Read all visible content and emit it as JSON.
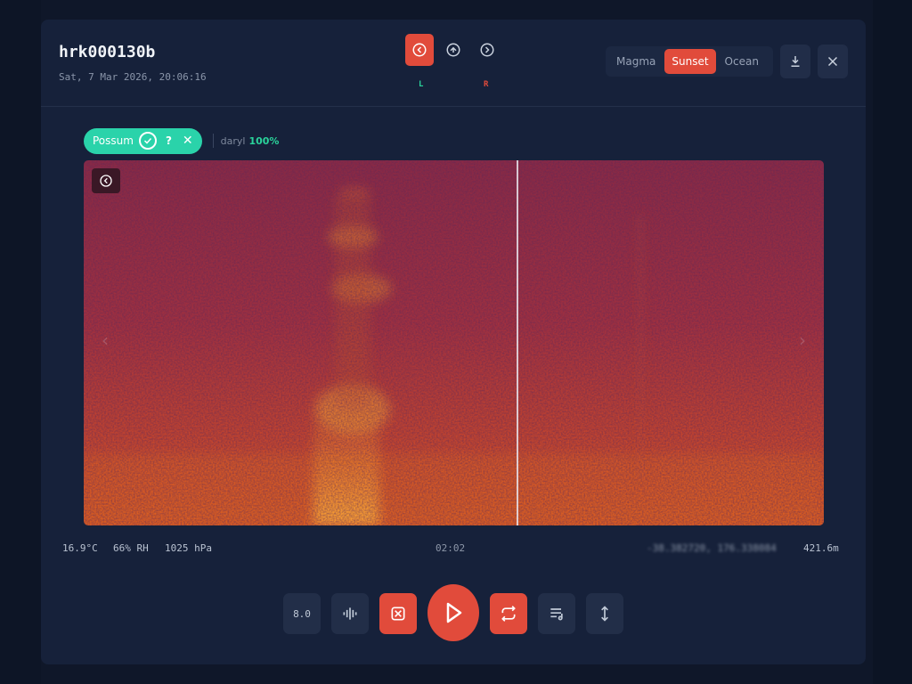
{
  "recording": {
    "id": "hrk000130b",
    "datetime": "Sat, 7 Mar 2026, 20:06:16"
  },
  "channels": {
    "left_label": "L",
    "right_label": "R"
  },
  "palettes": {
    "options": [
      "Magma",
      "Sunset",
      "Ocean"
    ],
    "selected": "Sunset"
  },
  "annotation": {
    "species": "Possum",
    "question_mark": "?",
    "remove": "✕",
    "user": "daryl",
    "confidence": "100%"
  },
  "conditions": {
    "temperature": "16.9°C",
    "humidity": "66% RH",
    "pressure": "1025 hPa"
  },
  "playback": {
    "time": "02:02",
    "speed": "8.0"
  },
  "location": {
    "coordinates": "-38.382720, 176.338084",
    "altitude": "421.6m"
  },
  "colors": {
    "accent": "#e14b3b",
    "tag": "#2ad3aa",
    "left_channel": "#2ad39b",
    "panel": "#16213a"
  },
  "icons": {
    "channel_left": "rewind-circle-icon",
    "channel_up": "up-circle-icon",
    "channel_forward": "forward-circle-icon",
    "download": "download-icon",
    "close": "close-icon",
    "spectro_badge": "rewind-circle-icon",
    "waveform": "waveform-icon",
    "shuffle": "shuffle-icon",
    "play": "play-icon",
    "repeat": "repeat-icon",
    "playlist": "playlist-icon",
    "expand": "expand-vertical-icon"
  }
}
